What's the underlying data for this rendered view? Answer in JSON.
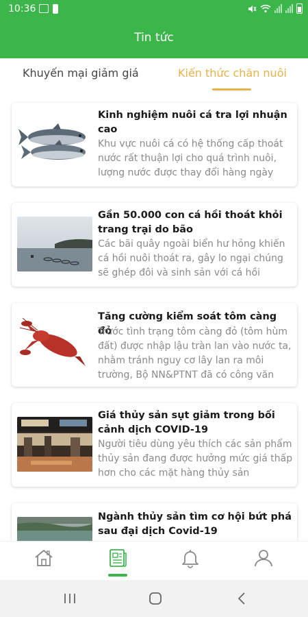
{
  "status_bar": {
    "time": "10:36"
  },
  "header": {
    "title": "Tin tức"
  },
  "tabs": [
    {
      "label": "Khuyến mại giảm giá",
      "active": false
    },
    {
      "label": "Kiến thức chăn nuôi",
      "active": true
    }
  ],
  "articles": [
    {
      "title": "Kinh nghiệm nuôi cá tra lợi nhuận cao",
      "description": "Khu vực nuôi cá có hệ thống cấp thoát nước rất thuận lợi cho quá trình nuôi, lượng nước được thay đổi hàng ngày",
      "image": "pangasius-fish"
    },
    {
      "title": "Gần 50.000 con cá hồi thoát khỏi trang trại do bão",
      "description": "Các bãi quây ngoài biển hư hỏng khiến cá hồi nuôi thoát ra, gây lo ngại chúng sẽ ghép đôi và sinh sản với cá hồi",
      "image": "salmon-farm"
    },
    {
      "title": "Tăng cường kiểm soát tôm càng đỏ",
      "description": "Trước tình trạng tôm càng đỏ (tôm hùm đất) được nhập lậu tràn lan vào nước ta, nhằm tránh nguy cơ lây lan ra môi trường, Bộ NN&PTNT đã có công văn",
      "image": "red-crayfish"
    },
    {
      "title": "Giá thủy sản sụt giảm trong bối cảnh dịch COVID-19",
      "description": "Người tiêu dùng yêu thích các sản phẩm thủy sản đang được hưởng mức giá thấp hơn cho các mặt hàng thủy sản",
      "image": "seafood-market"
    },
    {
      "title": "Ngành thủy sản tìm cơ hội bứt phá sau đại dịch Covid-19",
      "description": "",
      "image": "lake-landscape"
    }
  ],
  "bottom_nav": [
    {
      "icon": "home-icon",
      "active": false
    },
    {
      "icon": "news-icon",
      "active": true
    },
    {
      "icon": "bell-icon",
      "active": false
    },
    {
      "icon": "user-icon",
      "active": false
    }
  ],
  "colors": {
    "primary": "#3cb64b",
    "accent": "#e6b24a"
  }
}
